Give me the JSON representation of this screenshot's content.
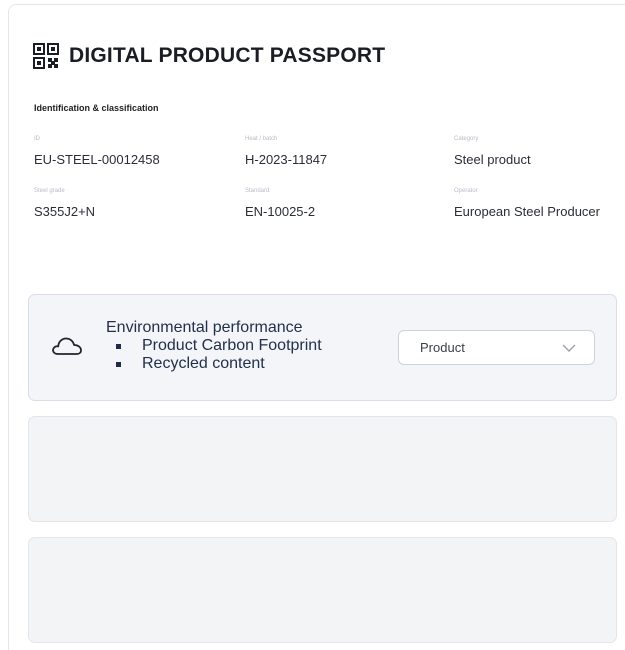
{
  "header": {
    "icon": "qr-code-icon",
    "title": "DIGITAL PRODUCT PASSPORT"
  },
  "identification": {
    "section_label": "Identification & classification",
    "fields": [
      {
        "label": "ID",
        "value": "EU-STEEL-00012458"
      },
      {
        "label": "Heat / batch",
        "value": "H-2023-11847"
      },
      {
        "label": "Category",
        "value": "Steel product"
      },
      {
        "label": "Steel grade",
        "value": "S355J2+N"
      },
      {
        "label": "Standard",
        "value": "EN-10025-2"
      },
      {
        "label": "Operator",
        "value": "European Steel Producer"
      }
    ]
  },
  "environmental": {
    "icon": "cloud-icon",
    "title": "Environmental performance",
    "items": [
      "Product Carbon Footprint",
      "Recycled content"
    ],
    "select": {
      "value": "Product",
      "icon": "chevron-down-icon"
    }
  },
  "colors": {
    "accent_navy": "#1f2b4a",
    "panel_bg": "#f3f5f9",
    "placeholder_bg": "#f3f4f6"
  }
}
